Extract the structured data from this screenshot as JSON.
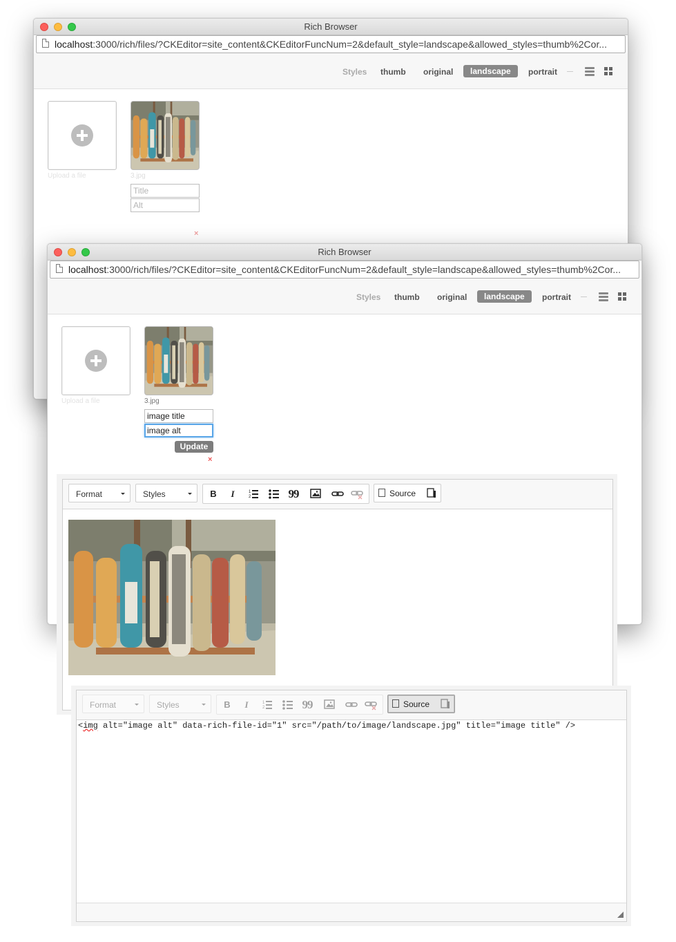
{
  "window": {
    "title": "Rich Browser",
    "url_host": "localhost",
    "url_rest": ":3000/rich/files/?CKEditor=site_content&CKEditorFuncNum=2&default_style=landscape&allowed_styles=thumb%2Cor..."
  },
  "styles_bar": {
    "label": "Styles",
    "items": [
      "thumb",
      "original",
      "landscape",
      "portrait"
    ],
    "active": "landscape",
    "sep": "—"
  },
  "upload": {
    "label": "Upload a file"
  },
  "file_back": {
    "name": "3.jpg",
    "title_placeholder": "Title",
    "alt_placeholder": "Alt",
    "delete": "×"
  },
  "file_front": {
    "name": "3.jpg",
    "title_value": "image title",
    "alt_value": "image alt",
    "update_label": "Update",
    "delete": "×"
  },
  "editor": {
    "format_label": "Format",
    "styles_label": "Styles",
    "source_label": "Source",
    "bold": "B",
    "italic": "I",
    "quote": "99"
  },
  "source_editor": {
    "format_label": "Format",
    "styles_label": "Styles",
    "source_label": "Source",
    "code_tag": "img",
    "code_rest": " alt=\"image alt\" data-rich-file-id=\"1\" src=\"/path/to/image/landscape.jpg\" title=\"image title\" />"
  },
  "icons": [
    "file-icon",
    "layers-icon",
    "grid-icon",
    "plus-icon",
    "bold-icon",
    "italic-icon",
    "numbered-list-icon",
    "bullet-list-icon",
    "blockquote-icon",
    "image-icon",
    "link-icon",
    "unlink-icon",
    "source-icon",
    "maximize-icon",
    "resize-grip-icon"
  ]
}
